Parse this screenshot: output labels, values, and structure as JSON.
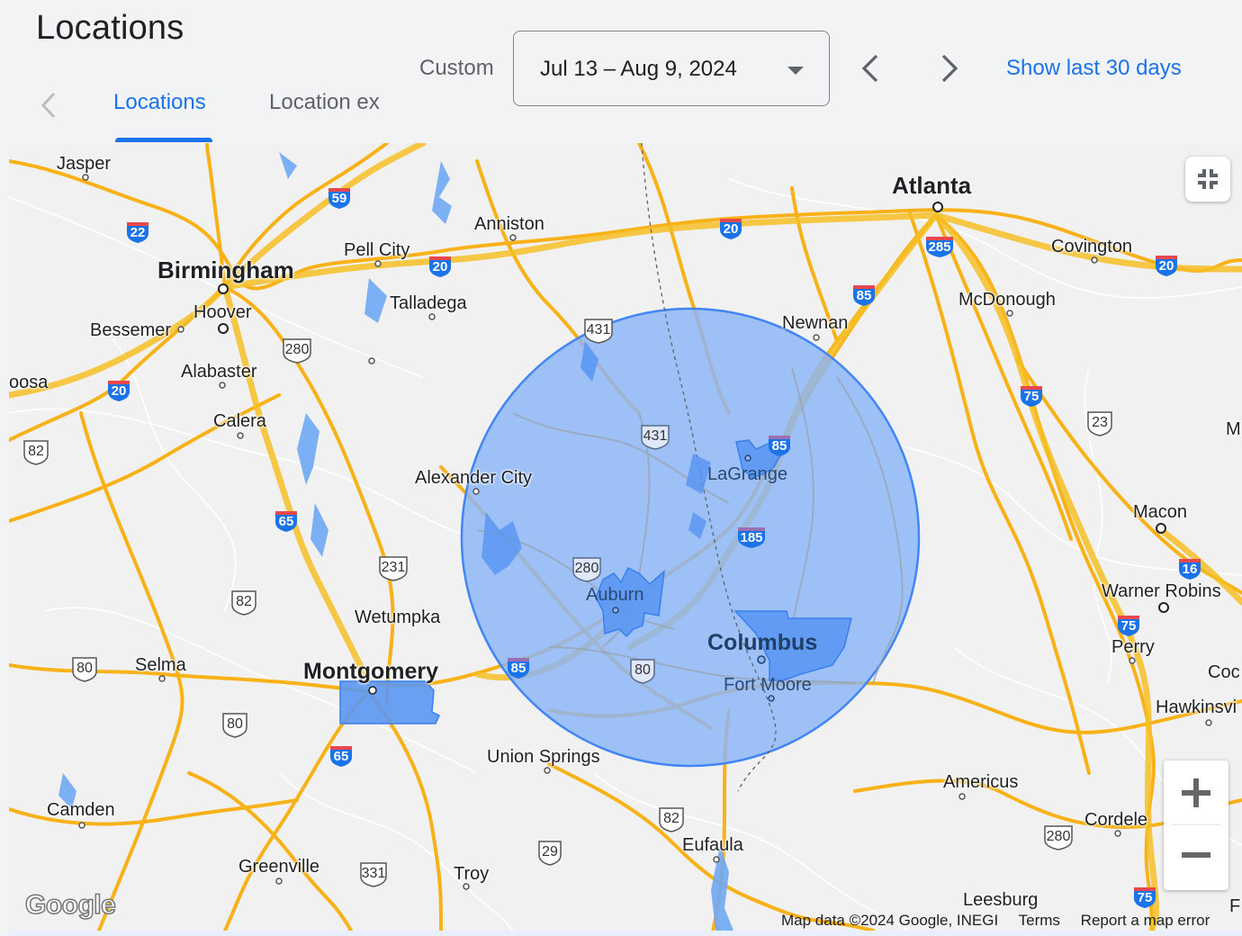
{
  "header": {
    "title": "Locations",
    "period_label": "Custom",
    "date_range": "Jul 13 – Aug 9, 2024",
    "show_last_label": "Show last 30 days"
  },
  "tabs": [
    {
      "label": "Locations",
      "active": true
    },
    {
      "label": "Location ex",
      "active": false
    }
  ],
  "colors": {
    "accent": "#1a73e8",
    "radius_fill": "#8ab4f8",
    "radius_stroke": "#4285f4",
    "road_major": "#fbbc04",
    "background": "#f1f3f4"
  },
  "map": {
    "cities": [
      {
        "name": "Jasper"
      },
      {
        "name": "Birmingham"
      },
      {
        "name": "Hoover"
      },
      {
        "name": "Bessemer"
      },
      {
        "name": "Alabaster"
      },
      {
        "name": "Calera"
      },
      {
        "name": "oosa"
      },
      {
        "name": "Pell City"
      },
      {
        "name": "Talladega"
      },
      {
        "name": "Anniston"
      },
      {
        "name": "Atlanta"
      },
      {
        "name": "Covington"
      },
      {
        "name": "McDonough"
      },
      {
        "name": "Newnan"
      },
      {
        "name": "Alexander City"
      },
      {
        "name": "LaGrange"
      },
      {
        "name": "Auburn"
      },
      {
        "name": "Columbus"
      },
      {
        "name": "Fort Moore"
      },
      {
        "name": "Wetumpka"
      },
      {
        "name": "Montgomery"
      },
      {
        "name": "Selma"
      },
      {
        "name": "Union Springs"
      },
      {
        "name": "Camden"
      },
      {
        "name": "Greenville"
      },
      {
        "name": "Troy"
      },
      {
        "name": "Eufaula"
      },
      {
        "name": "Americus"
      },
      {
        "name": "Cordele"
      },
      {
        "name": "Leesburg"
      },
      {
        "name": "Macon"
      },
      {
        "name": "Warner Robins"
      },
      {
        "name": "Perry"
      },
      {
        "name": "Hawkinsvi"
      },
      {
        "name": "Coc"
      },
      {
        "name": "M"
      },
      {
        "name": "F"
      }
    ],
    "interstates": [
      "59",
      "22",
      "20",
      "20",
      "20",
      "20",
      "285",
      "85",
      "85",
      "185",
      "65",
      "65",
      "75",
      "75",
      "16",
      "75"
    ],
    "us_highways": [
      "280",
      "431",
      "431",
      "82",
      "231",
      "82",
      "280",
      "80",
      "80",
      "80",
      "331",
      "29",
      "82",
      "23",
      "280"
    ],
    "google_logo": "Google",
    "attribution": {
      "map_data": "Map data ©2024 Google, INEGI",
      "terms": "Terms",
      "report": "Report a map error"
    },
    "controls": {
      "fullscreen_exit": "exit-fullscreen",
      "zoom_in": "+",
      "zoom_out": "−"
    }
  }
}
